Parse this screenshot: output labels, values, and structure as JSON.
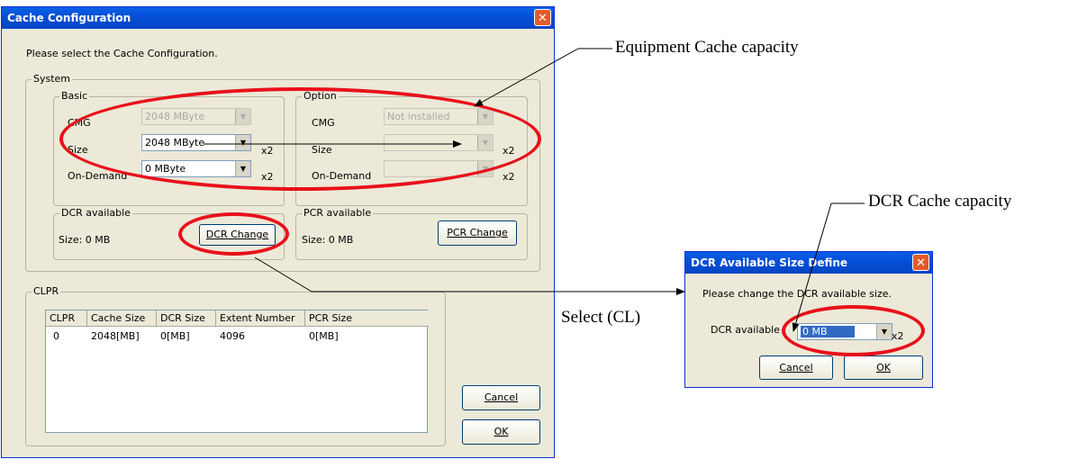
{
  "main_dialog": {
    "title": "Cache Configuration",
    "close_glyph": "✕",
    "instruction": "Please select the Cache Configuration.",
    "system_group": "System",
    "basic_group": "Basic",
    "option_group": "Option",
    "basic": {
      "cmg_label": "CMG",
      "cmg_value": "2048 MByte",
      "size_label": "Size",
      "size_value": "2048 MByte",
      "ondemand_label": "On-Demand",
      "ondemand_value": "0 MByte",
      "multiplier": "x2"
    },
    "option": {
      "cmg_label": "CMG",
      "cmg_value": "Not installed",
      "size_label": "Size",
      "size_value": "",
      "ondemand_label": "On-Demand",
      "ondemand_value": "",
      "multiplier": "x2"
    },
    "dcr_group": "DCR available",
    "dcr_size": "Size: 0 MB",
    "dcr_button": "DCR Change",
    "pcr_group": "PCR available",
    "pcr_size": "Size: 0 MB",
    "pcr_button": "PCR Change",
    "clpr_group": "CLPR",
    "table": {
      "headers": [
        "CLPR",
        "Cache Size",
        "DCR Size",
        "Extent Number",
        "PCR Size"
      ],
      "rows": [
        [
          "0",
          "2048[MB]",
          "0[MB]",
          "4096",
          "0[MB]"
        ]
      ]
    },
    "cancel_button": "Cancel",
    "ok_button": "OK"
  },
  "dcr_dialog": {
    "title": "DCR Available Size Define",
    "close_glyph": "✕",
    "instruction": "Please change the DCR available size.",
    "field_label": "DCR available",
    "field_value": "0 MB",
    "multiplier": "x2",
    "cancel_button": "Cancel",
    "ok_button": "OK"
  },
  "annotations": {
    "equipment": "Equipment Cache capacity",
    "dcr": "DCR Cache capacity",
    "select": "Select (CL)"
  },
  "colors": {
    "highlight": "#e8101a",
    "titlebar": "#0550d8"
  }
}
